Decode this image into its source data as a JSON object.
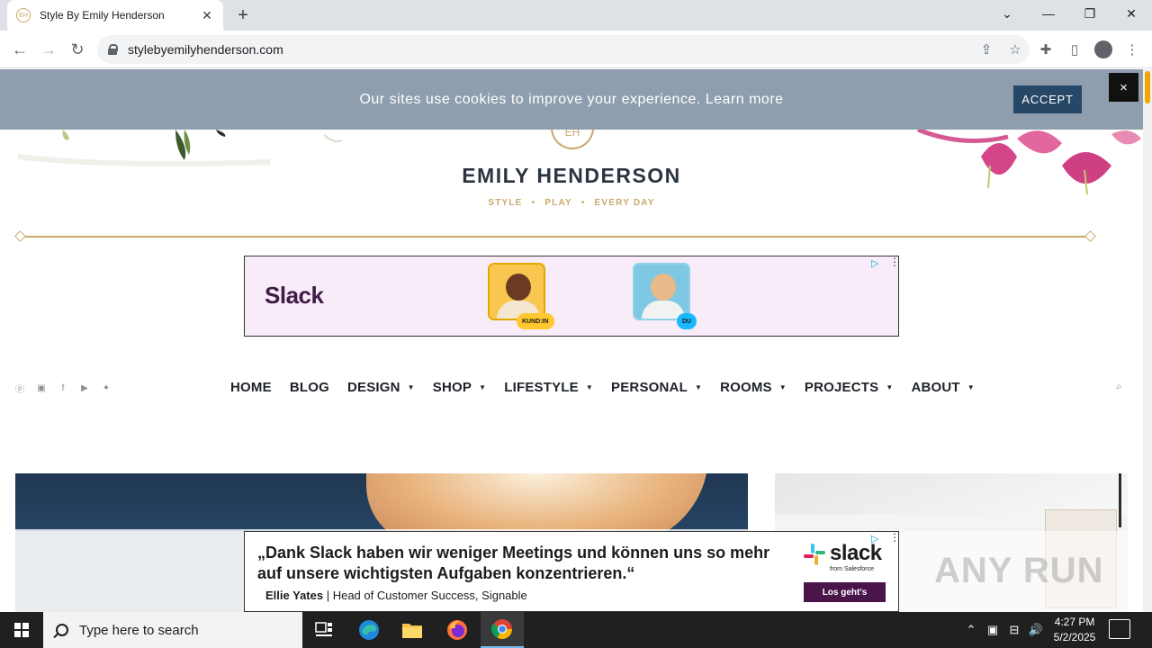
{
  "browser": {
    "tab_title": "Style By Emily Henderson",
    "url": "stylebyemilyhenderson.com"
  },
  "cookie_banner": {
    "message": "Our sites use cookies to improve your experience. Learn more",
    "accept_label": "ACCEPT",
    "close_label": "×"
  },
  "header": {
    "logo_mark": "EH",
    "site_title": "EMILY HENDERSON",
    "tagline": [
      "STYLE",
      "PLAY",
      "EVERY DAY"
    ]
  },
  "ad_top": {
    "brand": "Slack",
    "badge_left": "KUND:IN",
    "badge_right": "DU"
  },
  "nav": {
    "items": [
      {
        "label": "HOME",
        "dropdown": false
      },
      {
        "label": "BLOG",
        "dropdown": false
      },
      {
        "label": "DESIGN",
        "dropdown": true
      },
      {
        "label": "SHOP",
        "dropdown": true
      },
      {
        "label": "LIFESTYLE",
        "dropdown": true
      },
      {
        "label": "PERSONAL",
        "dropdown": true
      },
      {
        "label": "ROOMS",
        "dropdown": true
      },
      {
        "label": "PROJECTS",
        "dropdown": true
      },
      {
        "label": "ABOUT",
        "dropdown": true
      }
    ],
    "social_icons": [
      "pinterest-icon",
      "instagram-icon",
      "facebook-icon",
      "youtube-icon",
      "twitter-icon"
    ]
  },
  "ad_bottom": {
    "quote": "„Dank Slack haben wir weniger Meetings und können uns so mehr auf unsere wichtigsten Aufgaben konzentrieren.“",
    "author_name": "Ellie Yates",
    "author_role": " | Head of Customer Success, Signable",
    "logo_word": "slack",
    "logo_from": "from Salesforce",
    "cta_label": "Los geht's"
  },
  "watermark": "ANY RUN",
  "taskbar": {
    "search_placeholder": "Type here to search",
    "time": "4:27 PM",
    "date": "5/2/2025"
  },
  "colors": {
    "gold": "#c9a96a",
    "cookie_bg": "#8f9eae",
    "accept_bg": "#274766",
    "slack_aubergine": "#4a154b"
  }
}
